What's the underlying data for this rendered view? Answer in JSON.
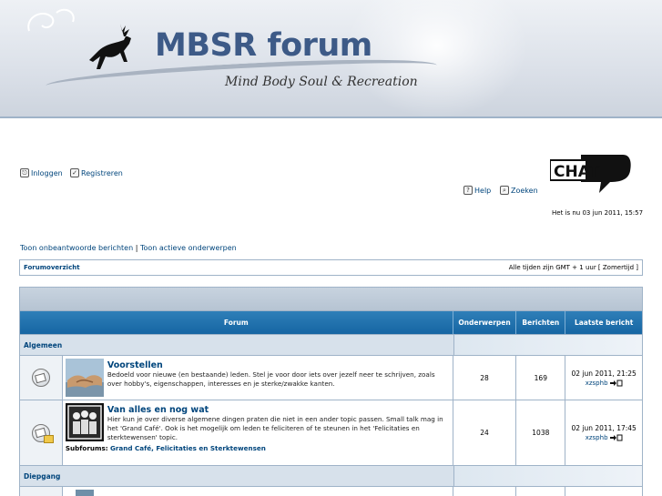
{
  "header": {
    "title": "MBSR forum",
    "subtitle": "Mind Body Soul & Recreation"
  },
  "top_links": {
    "login": "Inloggen",
    "register": "Registreren",
    "help": "Help",
    "search": "Zoeken"
  },
  "chat_logo_text": "CHAT",
  "current_time": "Het is nu 03 jun 2011, 15:57",
  "quick_links": {
    "unanswered": "Toon onbeantwoorde berichten",
    "separator": "|",
    "active": "Toon actieve onderwerpen"
  },
  "navbar": {
    "crumb": "Forumoverzicht",
    "timezone": "Alle tijden zijn GMT + 1 uur [ Zomertijd ]"
  },
  "table": {
    "headers": {
      "forum": "Forum",
      "topics": "Onderwerpen",
      "posts": "Berichten",
      "last_post": "Laatste bericht"
    },
    "categories": [
      {
        "name": "Algemeen",
        "forums": [
          {
            "name": "Voorstellen",
            "description": "Bedoeld voor nieuwe (en bestaande) leden. Stel je voor door iets over jezelf neer te schrijven, zoals over hobby's, eigenschappen, interesses en je sterke/zwakke kanten.",
            "topics": "28",
            "posts": "169",
            "last_date": "02 jun 2011, 21:25",
            "last_user": "xzsphb"
          },
          {
            "name": "Van alles en nog wat",
            "description": "Hier kun je over diverse algemene dingen praten die niet in een ander topic passen. Small talk mag in het 'Grand Café'. Ook is het mogelijk om leden te feliciteren of te steunen in het 'Felicitaties en sterktewensen' topic.",
            "subforums_label": "Subforums:",
            "subforums": "Grand Café, Felicitaties en Sterktewensen",
            "topics": "24",
            "posts": "1038",
            "last_date": "02 jun 2011, 17:45",
            "last_user": "xzsphb"
          }
        ]
      },
      {
        "name": "Diepgang",
        "forums": []
      }
    ]
  },
  "colors": {
    "link": "#00457c",
    "header_bar": "#1666a3",
    "border": "#9fb3c8"
  }
}
